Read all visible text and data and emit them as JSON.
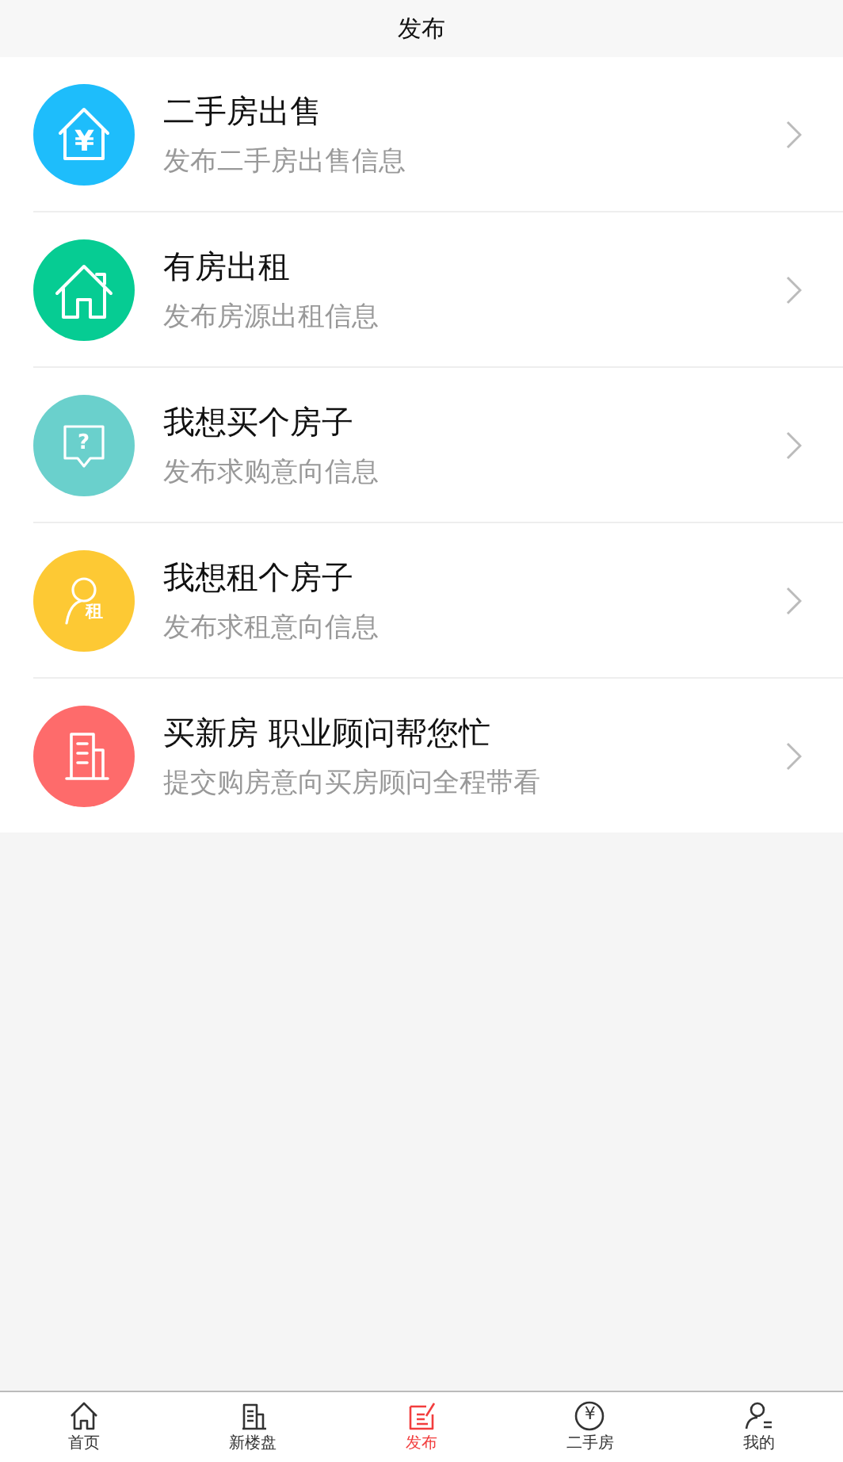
{
  "header": {
    "title": "发布"
  },
  "items": [
    {
      "kind": "sale",
      "color": "#1ebdfb",
      "icon_glyph": "¥",
      "title": "二手房出售",
      "subtitle": "发布二手房出售信息"
    },
    {
      "kind": "rent",
      "color": "#06cc93",
      "title": "有房出租",
      "subtitle": "发布房源出租信息"
    },
    {
      "kind": "buy",
      "color": "#6ad0cc",
      "icon_glyph": "?",
      "title": "我想买个房子",
      "subtitle": "发布求购意向信息"
    },
    {
      "kind": "lease",
      "color": "#fdc934",
      "icon_glyph": "租",
      "title": "我想租个房子",
      "subtitle": "发布求租意向信息"
    },
    {
      "kind": "new",
      "color": "#fe6b6b",
      "title": "买新房 职业顾问帮您忙",
      "subtitle": "提交购房意向买房顾问全程带看"
    }
  ],
  "tabs": [
    {
      "kind": "home",
      "label": "首页",
      "selected": false
    },
    {
      "kind": "building",
      "label": "新楼盘",
      "selected": false
    },
    {
      "kind": "post",
      "label": "发布",
      "selected": true
    },
    {
      "kind": "coin",
      "label": "二手房",
      "icon_glyph": "¥",
      "selected": false
    },
    {
      "kind": "user",
      "label": "我的",
      "selected": false
    }
  ]
}
